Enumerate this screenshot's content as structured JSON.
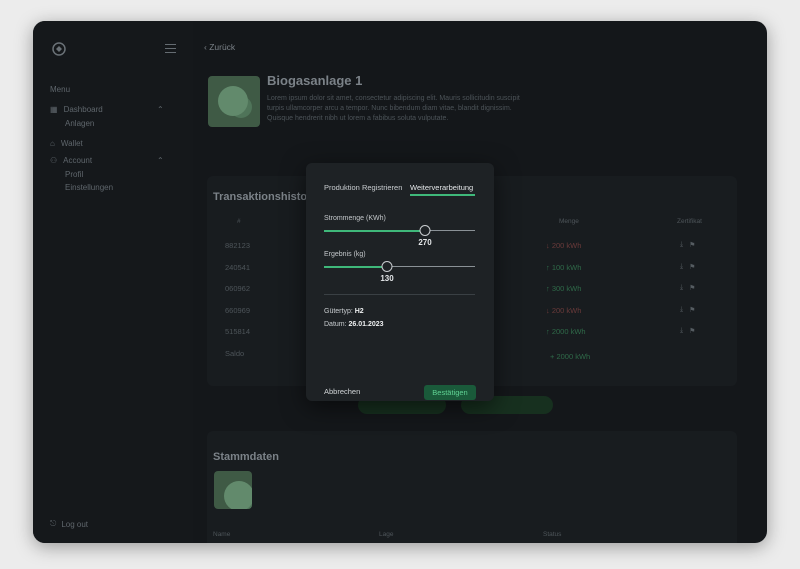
{
  "sidebar": {
    "menu_title": "Menu",
    "items": [
      {
        "label": "Dashboard",
        "icon": "grid-icon"
      },
      {
        "label": "Anlagen"
      },
      {
        "label": "Wallet",
        "icon": "home-icon"
      },
      {
        "label": "Account",
        "icon": "user-icon"
      },
      {
        "label": "Profil"
      },
      {
        "label": "Einstellungen"
      }
    ],
    "logout": "Log out"
  },
  "main": {
    "back_label": "Zurück",
    "title": "Biogasanlage 1",
    "description": "Lorem ipsum dolor sit amet, consectetur adipiscing elit. Mauris sollicitudin suscipit turpis ullamcorper arcu a tempor. Nunc bibendum diam vitae, blandit dignissim. Quisque hendrerit nibh ut lorem a fabibus soluta vulputate.",
    "history_title": "Transaktionshistorie",
    "col_id": "#",
    "col_amount": "Menge",
    "col_cert": "Zertifikat",
    "rows": [
      {
        "id": "882123",
        "amount": "↓ 200 kWh"
      },
      {
        "id": "240541",
        "amount": "↑ 100 kWh"
      },
      {
        "id": "060962",
        "amount": "↑ 300 kWh"
      },
      {
        "id": "660969",
        "amount": "↓ 200 kWh"
      },
      {
        "id": "515814",
        "amount": "↑ 2000 kWh"
      }
    ],
    "sum_label": "Saldo",
    "sum_value": "+ 2000 kWh",
    "stamm_title": "Stammdaten",
    "stamm_col1": "Name",
    "stamm_col2": "Lage",
    "stamm_col3": "Status"
  },
  "modal": {
    "tab1": "Produktion Registrieren",
    "tab2": "Weiterverarbeitung",
    "field1_label": "Strommenge (KWh)",
    "field1_value": "270",
    "field1_fraction": 0.67,
    "field2_label": "Ergebnis (kg)",
    "field2_value": "130",
    "field2_fraction": 0.42,
    "goods_label": "Gütertyp:",
    "goods_value": "H2",
    "date_label": "Datum:",
    "date_value": "26.01.2023",
    "cancel": "Abbrechen",
    "confirm": "Bestätigen"
  }
}
